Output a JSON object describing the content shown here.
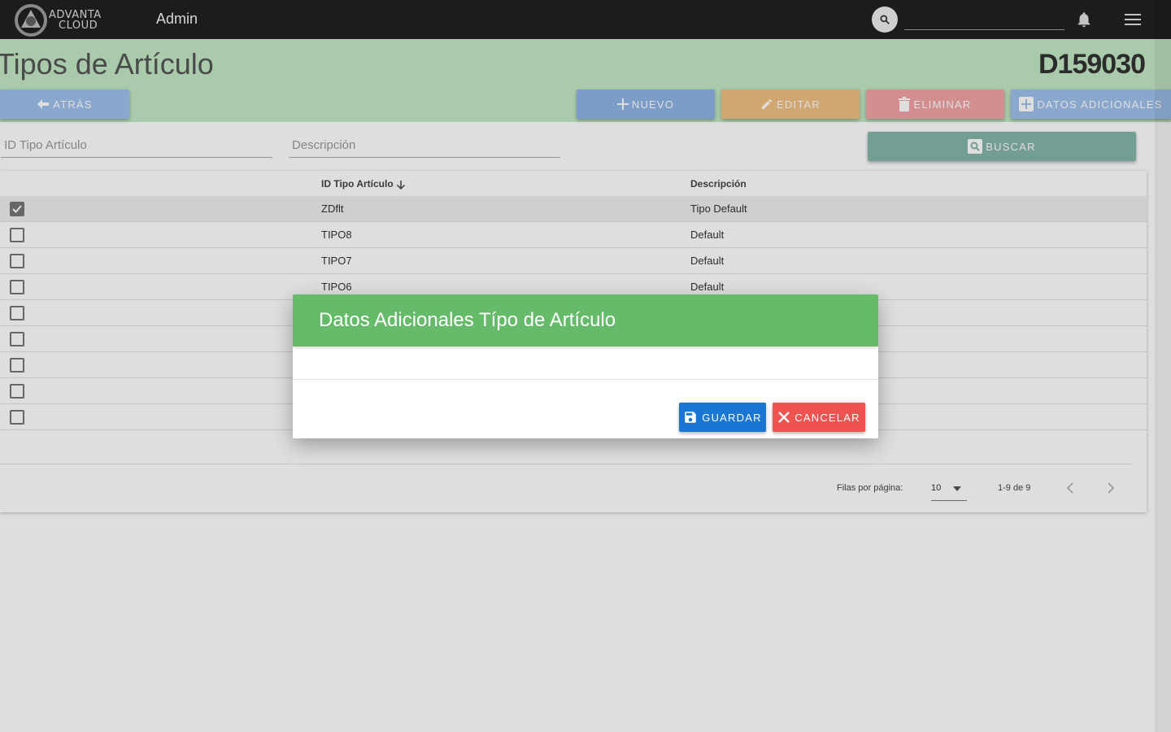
{
  "topbar": {
    "logo_line1": "ADVANTA",
    "logo_line2": "CLOUD",
    "title": "Admin",
    "search_value": "",
    "icons": [
      "search-icon",
      "bell-icon",
      "menu-icon"
    ]
  },
  "header": {
    "page_title": "Tipos de Artículo",
    "code": "D159030"
  },
  "toolbar": {
    "atras": "ATRÁS",
    "nuevo": "NUEVO",
    "editar": "EDITAR",
    "eliminar": "ELIMINAR",
    "datos_adicionales": "DATOS ADICIONALES",
    "buscar": "BUSCAR"
  },
  "filters": {
    "id_placeholder": "ID Tipo Artículo",
    "desc_placeholder": "Descripción"
  },
  "table": {
    "columns": [
      "ID Tipo Artículo",
      "Descripción"
    ],
    "rows": [
      {
        "id": "ZDflt",
        "desc": "Tipo Default",
        "checked": true
      },
      {
        "id": "TIPO8",
        "desc": "Default",
        "checked": false
      },
      {
        "id": "TIPO7",
        "desc": "Default",
        "checked": false
      },
      {
        "id": "TIPO6",
        "desc": "Default",
        "checked": false
      },
      {
        "id": "",
        "desc": "",
        "checked": false
      },
      {
        "id": "",
        "desc": "",
        "checked": false
      },
      {
        "id": "",
        "desc": "",
        "checked": false
      },
      {
        "id": "",
        "desc": "",
        "checked": false
      },
      {
        "id": "",
        "desc": "",
        "checked": false
      }
    ]
  },
  "pagination": {
    "rows_per_page_label": "Filas por página:",
    "rows_per_page": "10",
    "range": "1-9 de 9"
  },
  "dialog": {
    "title": "Datos Adicionales Típo de Artículo",
    "save": "GUARDAR",
    "cancel": "CANCELAR"
  },
  "colors": {
    "topbar": "#212121",
    "header": "#c3e8c5",
    "dialog_header": "#66bb6a",
    "save": "#1976d2",
    "cancel": "#ef5350"
  }
}
